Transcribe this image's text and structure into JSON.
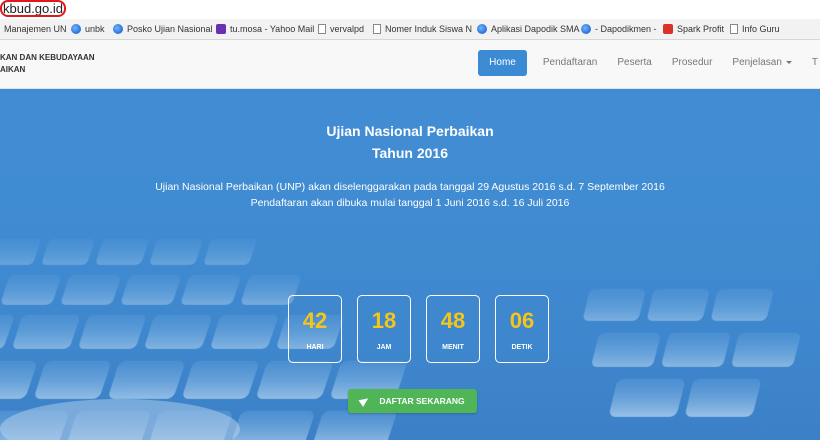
{
  "browser": {
    "url": "kbud.go.id",
    "bookmarks": [
      {
        "label": "Manajemen UN",
        "icon": "globe-icon"
      },
      {
        "label": "unbk",
        "icon": "globe-icon"
      },
      {
        "label": "Posko Ujian Nasional",
        "icon": "globe-icon"
      },
      {
        "label": "tu.mosa - Yahoo Mail",
        "icon": "mail-icon"
      },
      {
        "label": "vervalpd",
        "icon": "page-icon"
      },
      {
        "label": "Nomer Induk Siswa N",
        "icon": "page-icon"
      },
      {
        "label": "Aplikasi Dapodik SMA",
        "icon": "globe-icon"
      },
      {
        "label": "- Dapodikmen -",
        "icon": "globe-icon"
      },
      {
        "label": "Spark Profit",
        "icon": "spark-icon"
      },
      {
        "label": "Info Guru",
        "icon": "page-icon"
      }
    ]
  },
  "site": {
    "brand_line1": "KAN DAN KEBUDAYAAN",
    "brand_line2": "AIKAN",
    "nav": {
      "home": "Home",
      "pendaftaran": "Pendaftaran",
      "peserta": "Peserta",
      "prosedur": "Prosedur",
      "penjelasan": "Penjelasan",
      "extra": "T"
    }
  },
  "hero": {
    "title_line1": "Ujian Nasional Perbaikan",
    "title_line2": "Tahun 2016",
    "desc_line1": "Ujian Nasional Perbaikan (UNP) akan diselenggarakan pada tanggal 29 Agustus 2016 s.d. 7 September 2016",
    "desc_line2": "Pendaftaran akan dibuka mulai tanggal 1 Juni 2016 s.d. 16 Juli 2016",
    "countdown": [
      {
        "value": "42",
        "label": "HARI"
      },
      {
        "value": "18",
        "label": "JAM"
      },
      {
        "value": "48",
        "label": "MENIT"
      },
      {
        "value": "06",
        "label": "DETIK"
      }
    ],
    "cta_label": "DAFTAR SEKARANG"
  },
  "colors": {
    "accent": "#3a8bd4",
    "countdown_number": "#f5c518",
    "cta": "#4fb557",
    "url_highlight": "#e0171e"
  }
}
